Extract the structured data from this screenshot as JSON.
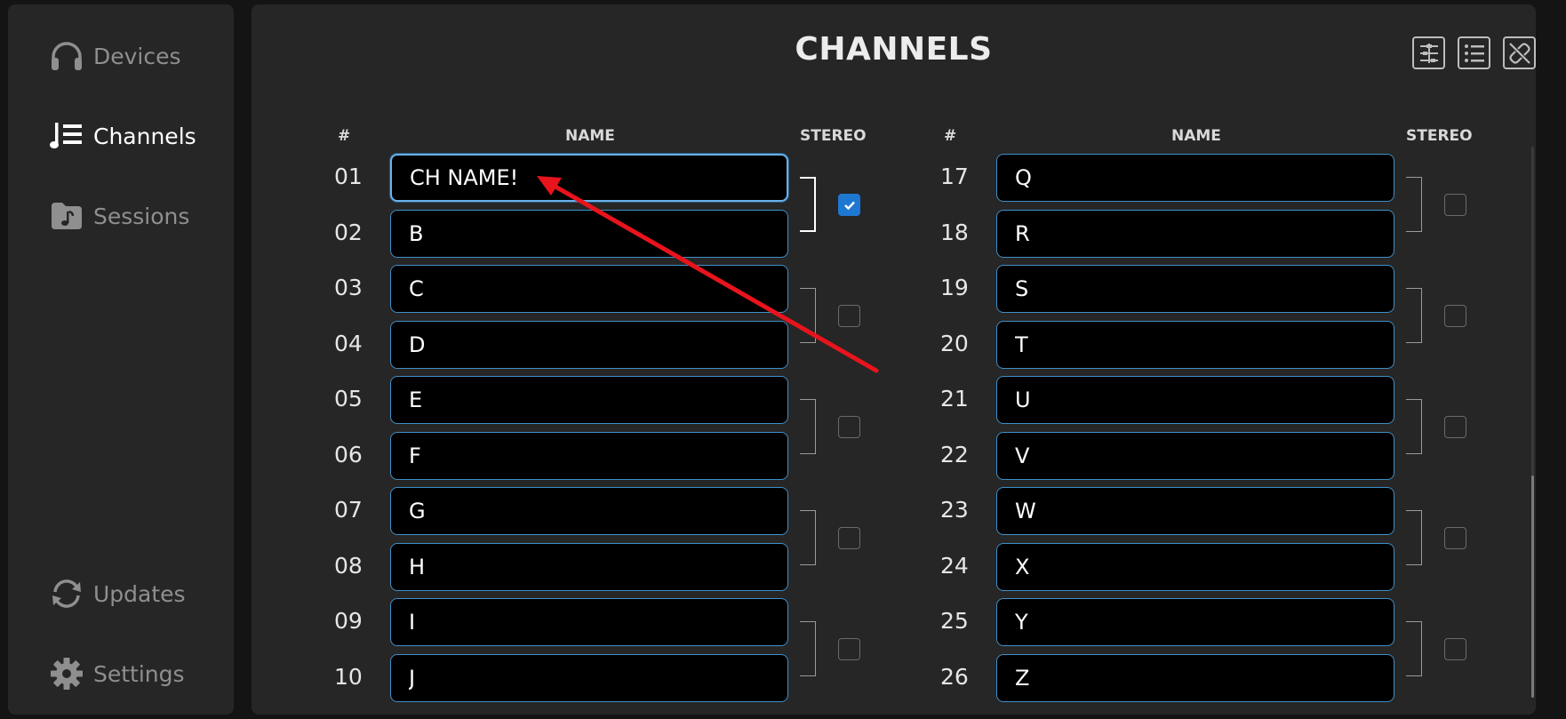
{
  "sidebar": {
    "items": [
      {
        "label": "Devices",
        "icon": "headphones-icon",
        "active": false
      },
      {
        "label": "Channels",
        "icon": "channel-list-icon",
        "active": true
      },
      {
        "label": "Sessions",
        "icon": "music-folder-icon",
        "active": false
      },
      {
        "label": "Updates",
        "icon": "refresh-icon",
        "active": false
      },
      {
        "label": "Settings",
        "icon": "gear-icon",
        "active": false
      }
    ]
  },
  "header": {
    "title": "CHANNELS",
    "tools": [
      "mixer-grid-icon",
      "list-icon",
      "unlink-icon"
    ]
  },
  "columns_header": {
    "num": "#",
    "name": "NAME",
    "stereo": "STEREO"
  },
  "left_channels": [
    {
      "num": "01",
      "name": "CH NAME!"
    },
    {
      "num": "02",
      "name": "B"
    },
    {
      "num": "03",
      "name": "C"
    },
    {
      "num": "04",
      "name": "D"
    },
    {
      "num": "05",
      "name": "E"
    },
    {
      "num": "06",
      "name": "F"
    },
    {
      "num": "07",
      "name": "G"
    },
    {
      "num": "08",
      "name": "H"
    },
    {
      "num": "09",
      "name": "I"
    },
    {
      "num": "10",
      "name": "J"
    }
  ],
  "right_channels": [
    {
      "num": "17",
      "name": "Q"
    },
    {
      "num": "18",
      "name": "R"
    },
    {
      "num": "19",
      "name": "S"
    },
    {
      "num": "20",
      "name": "T"
    },
    {
      "num": "21",
      "name": "U"
    },
    {
      "num": "22",
      "name": "V"
    },
    {
      "num": "23",
      "name": "W"
    },
    {
      "num": "24",
      "name": "X"
    },
    {
      "num": "25",
      "name": "Y"
    },
    {
      "num": "26",
      "name": "Z"
    }
  ],
  "left_stereo": [
    true,
    false,
    false,
    false,
    false
  ],
  "right_stereo": [
    false,
    false,
    false,
    false,
    false
  ],
  "colors": {
    "accent": "#1e78d2",
    "input_border": "#3f8fc7",
    "annotation": "#e8141c"
  }
}
